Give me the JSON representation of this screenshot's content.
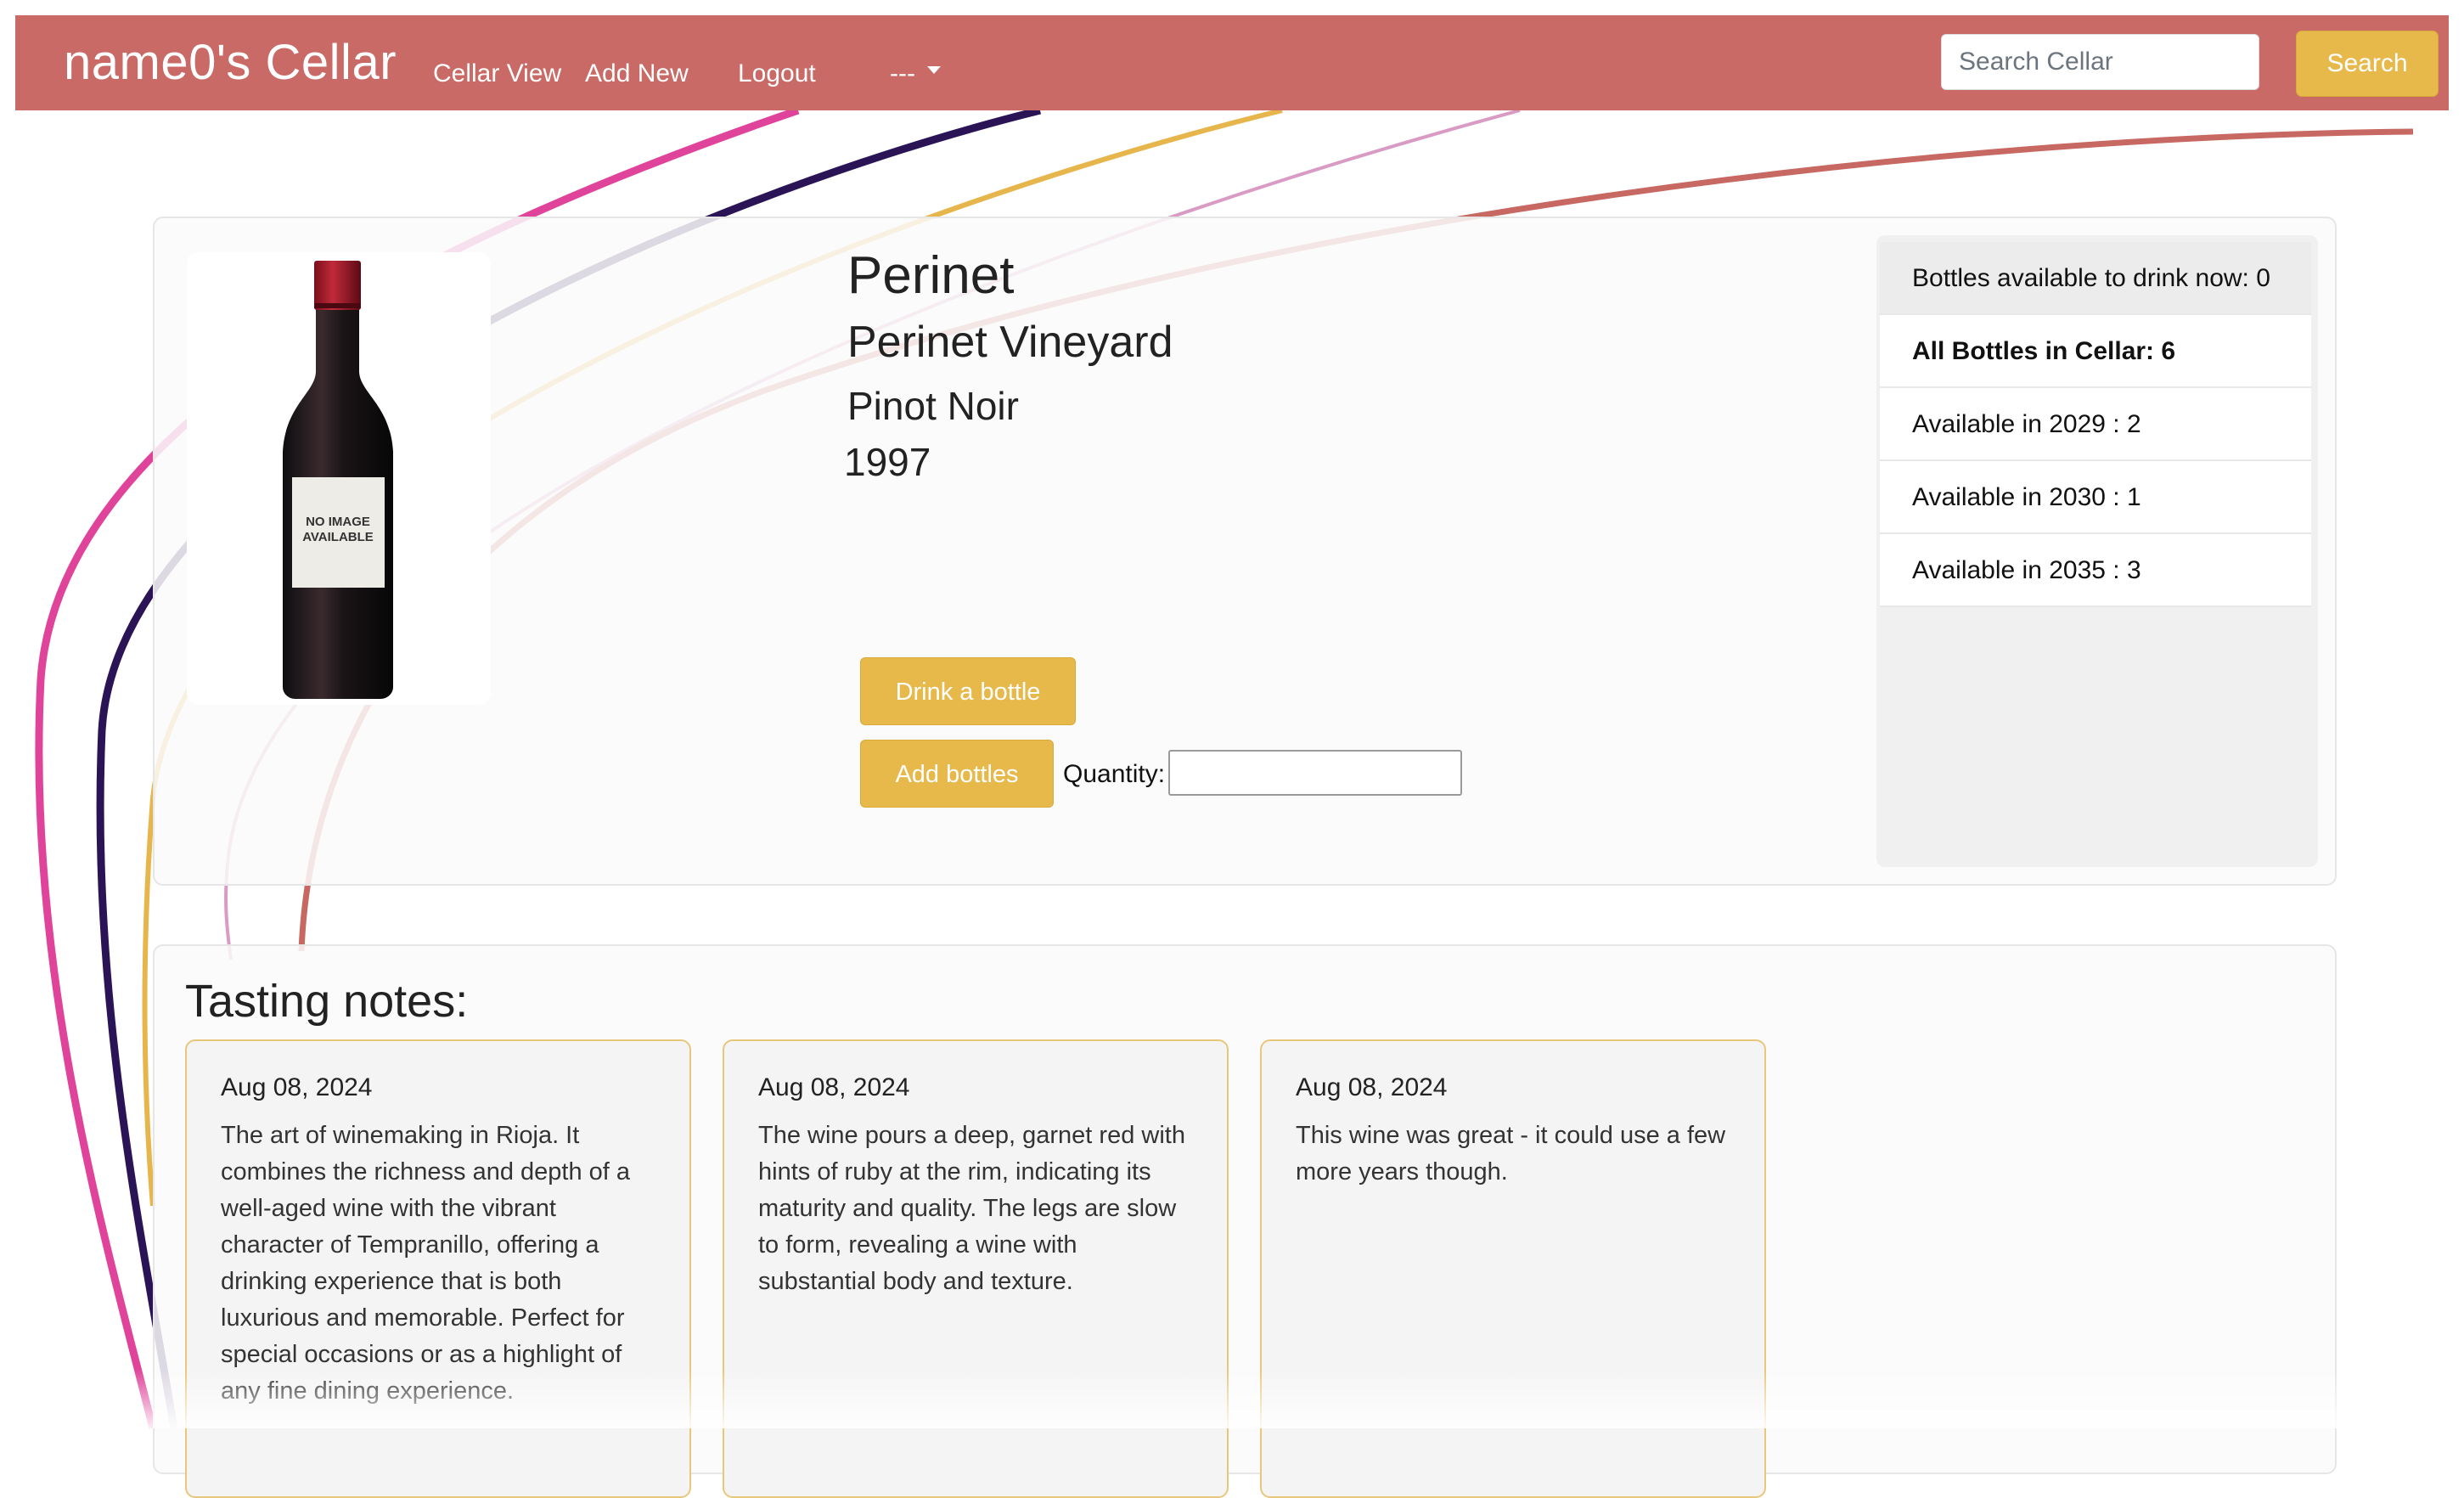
{
  "navbar": {
    "brand": "name0's Cellar",
    "links": [
      "Cellar View",
      "Add New",
      "Logout"
    ],
    "dropdown_label": "---",
    "search_placeholder": "Search Cellar",
    "search_button": "Search"
  },
  "wine": {
    "name": "Perinet",
    "vineyard": "Perinet Vineyard",
    "varietal": "Pinot Noir",
    "vintage": "1997",
    "image_label": "NO IMAGE AVAILABLE"
  },
  "actions": {
    "drink_button": "Drink a bottle",
    "add_button": "Add bottles",
    "quantity_label": "Quantity:",
    "quantity_value": ""
  },
  "availability": [
    "Bottles available to drink now: 0",
    "All Bottles in Cellar: 6",
    "Available in 2029 : 2",
    "Available in 2030 : 1",
    "Available in 2035 : 3"
  ],
  "tasting": {
    "title": "Tasting notes:",
    "notes": [
      {
        "date": "Aug 08, 2024",
        "text": "The art of winemaking in Rioja. It combines the richness and depth of a well-aged wine with the vibrant character of Tempranillo, offering a drinking experience that is both luxurious and memorable. Perfect for special occasions or as a highlight of any fine dining experience."
      },
      {
        "date": "Aug 08, 2024",
        "text": "The wine pours a deep, garnet red with hints of ruby at the rim, indicating its maturity and quality. The legs are slow to form, revealing a wine with substantial body and texture."
      },
      {
        "date": "Aug 08, 2024",
        "text": "This wine was great - it could use a few more years though."
      }
    ]
  },
  "colors": {
    "navbar": "#c96a66",
    "accent_gold": "#e7b84a",
    "swirl_pink": "#e0449a",
    "swirl_navy": "#2a1456",
    "swirl_gold": "#e6b64c",
    "swirl_rose": "#d99ac4",
    "swirl_red": "#c86862"
  }
}
